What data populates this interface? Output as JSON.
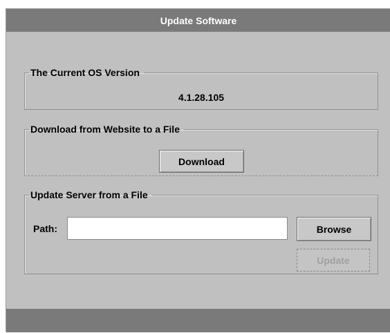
{
  "window": {
    "title": "Update Software"
  },
  "current_os": {
    "legend": "The Current OS Version",
    "version": "4.1.28.105"
  },
  "download": {
    "legend": "Download from Website to a File",
    "button_label": "Download"
  },
  "update_from_file": {
    "legend": "Update Server from a File",
    "path_label": "Path:",
    "path_value": "",
    "browse_label": "Browse",
    "update_label": "Update",
    "update_enabled": false
  },
  "colors": {
    "title_bar": "#7a7a7a",
    "panel_bg": "#c0c0c0",
    "disabled_text": "#a0a0a0"
  }
}
